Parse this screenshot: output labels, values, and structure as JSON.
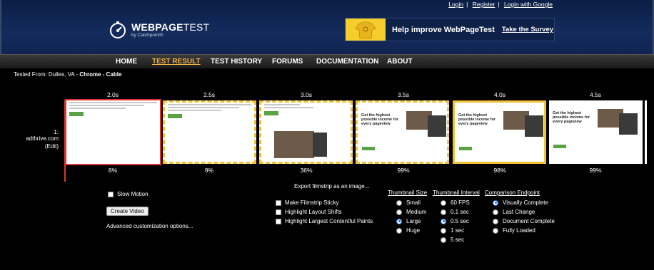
{
  "header": {
    "top_links": [
      "Login",
      "Register",
      "Login with Google"
    ],
    "logo": {
      "brand_bold": "WEBPAGE",
      "brand_thin": "TEST",
      "sub": "by Catchpoint®"
    },
    "promo": {
      "title": "Help improve WebPageTest",
      "cta": "Take the Survey"
    }
  },
  "nav": {
    "items": [
      "HOME",
      "TEST RESULT",
      "TEST HISTORY",
      "FORUMS",
      "DOCUMENTATION",
      "ABOUT"
    ],
    "active": "TEST RESULT"
  },
  "tested_from": {
    "prefix": "Tested From: Dulles, VA - ",
    "browser": "Chrome - Cable"
  },
  "filmstrip": {
    "row_label": "1: adthrive.com",
    "row_edit": "(Edit)",
    "frames": [
      {
        "time": "2.0s",
        "pct": "8%"
      },
      {
        "time": "2.5s",
        "pct": "9%"
      },
      {
        "time": "3.0s",
        "pct": "36%"
      },
      {
        "time": "3.5s",
        "pct": "99%"
      },
      {
        "time": "4.0s",
        "pct": "98%"
      },
      {
        "time": "4.5s",
        "pct": "99%"
      }
    ],
    "hero_text": "Get the highest possible income for every pageview"
  },
  "controls": {
    "slow_motion": "Slow Motion",
    "create_video": "Create Video",
    "advanced": "Advanced customization options...",
    "export": "Export filmstrip as an image...",
    "checkboxes": [
      "Highlight Layout Shifts",
      "Highlight Largest Contentful Paints",
      "Make Filmstrip Sticky"
    ],
    "thumbnail_size": {
      "title": "Thumbnail Size",
      "options": [
        "Small",
        "Medium",
        "Large",
        "Huge"
      ],
      "selected": "Large"
    },
    "thumbnail_interval": {
      "title": "Thumbnail Interval",
      "options": [
        "60 FPS",
        "0.1 sec",
        "0.5 sec",
        "1 sec",
        "5 sec"
      ],
      "selected": "0.5 sec"
    },
    "comparison_endpoint": {
      "title": "Comparison Endpoint",
      "options": [
        "Visually Complete",
        "Last Change",
        "Document Complete",
        "Fully Loaded"
      ],
      "selected": "Visually Complete"
    }
  }
}
